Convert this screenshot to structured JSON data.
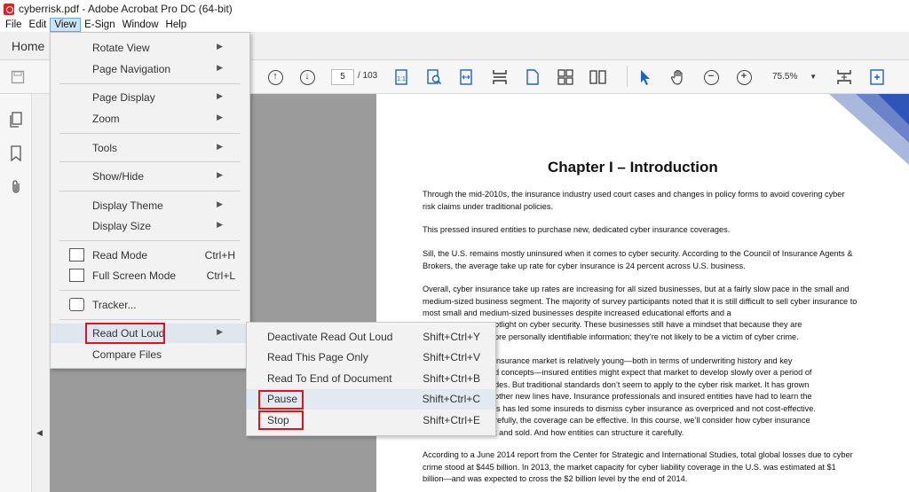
{
  "window": {
    "title": "cyberrisk.pdf - Adobe Acrobat Pro DC (64-bit)"
  },
  "menubar": {
    "items": [
      "File",
      "Edit",
      "View",
      "E-Sign",
      "Window",
      "Help"
    ]
  },
  "tabs": {
    "home": "Home"
  },
  "toolbar": {
    "page_current": "5",
    "page_total": "/ 103",
    "zoom": "75.5%"
  },
  "view_menu": {
    "items": [
      {
        "label": "Rotate View",
        "submenu": true
      },
      {
        "label": "Page Navigation",
        "submenu": true
      },
      {
        "label": "Page Display",
        "submenu": true
      },
      {
        "label": "Zoom",
        "submenu": true
      },
      {
        "label": "Tools",
        "submenu": true
      },
      {
        "label": "Show/Hide",
        "submenu": true
      },
      {
        "label": "Display Theme",
        "submenu": true
      },
      {
        "label": "Display Size",
        "submenu": true
      },
      {
        "label": "Read Mode",
        "shortcut": "Ctrl+H"
      },
      {
        "label": "Full Screen Mode",
        "shortcut": "Ctrl+L"
      },
      {
        "label": "Tracker..."
      },
      {
        "label": "Read Out Loud",
        "submenu": true
      },
      {
        "label": "Compare Files"
      }
    ]
  },
  "read_out_loud_menu": {
    "items": [
      {
        "label": "Deactivate Read Out Loud",
        "shortcut": "Shift+Ctrl+Y"
      },
      {
        "label": "Read This Page Only",
        "shortcut": "Shift+Ctrl+V"
      },
      {
        "label": "Read To End of Document",
        "shortcut": "Shift+Ctrl+B"
      },
      {
        "label": "Pause",
        "shortcut": "Shift+Ctrl+C"
      },
      {
        "label": "Stop",
        "shortcut": "Shift+Ctrl+E"
      }
    ]
  },
  "document": {
    "title": "Chapter I – Introduction",
    "paragraphs": [
      "Through the mid-2010s, the insurance industry used court cases and changes in policy forms to avoid covering cyber risk claims under traditional policies.",
      "This pressed insured entities to purchase new, dedicated cyber insurance coverages.",
      "Sill, the U.S. remains mostly uninsured when it comes to cyber security. According to the Council of Insurance Agents & Brokers, the average take up rate for cyber insurance is 24 percent across U.S. business.",
      "Overall, cyber insurance take up rates are increasing for all sized businesses, but at a fairly slow pace in the small and medium-sized business segment. The majority of survey participants noted that it is still difficult to sell cyber insurance to most small and medium-sized businesses despite increased educational efforts and a",
      "otlight on cyber security. These businesses still have a mindset that because they are",
      "ore personally identifiable information; they’re not likely to be a victim of cyber crime.",
      "insurance market is relatively young—both in terms of underwriting history and key",
      "d concepts—insured entities might expect that market to develop slowly over a period of",
      "des. But traditional standards don’t seem to apply to the cyber risk market. It has grown",
      "other new lines have. Insurance professionals and insured entities have had to learn the",
      "is has led some insureds to dismiss cyber insurance as overpriced and not cost-effective.",
      "refully, the coverage can be effective. In this course, we’ll consider how cyber insurance",
      "t and sold. And how entities can structure it carefully.",
      "According to a June 2014 report from the Center for Strategic and International Studies, total global losses due to cyber crime stood at $445 billion. In 2013, the market capacity for cyber liability coverage in the U.S. was estimated at $1 billion—and was expected to cross the $2 billion level by the end of 2014."
    ]
  }
}
